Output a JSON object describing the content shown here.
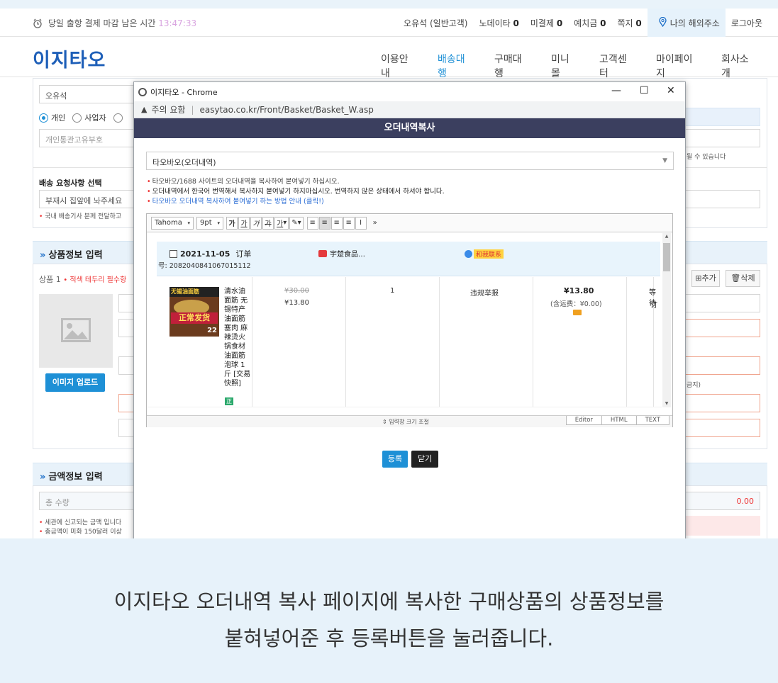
{
  "topbar": {
    "deadline_label": "당일 출항 결제 마감 남은 시간",
    "deadline_time": "13:47:33",
    "user": "오유석 (일반고객)",
    "items": [
      {
        "label": "노데이타",
        "count": "0"
      },
      {
        "label": "미결제",
        "count": "0"
      },
      {
        "label": "예치금",
        "count": "0"
      },
      {
        "label": "쪽지",
        "count": "0"
      }
    ],
    "my_address": "나의 해외주소",
    "logout": "로그아웃"
  },
  "nav": {
    "logo": "이지타오",
    "menu": [
      "이용안내",
      "배송대행",
      "구매대행",
      "미니몰",
      "고객센터",
      "마이페이지",
      "회사소개"
    ],
    "active_index": 1
  },
  "background": {
    "name_value": "오유석",
    "radio_personal": "개인",
    "radio_business": "사업자",
    "customs_placeholder": "개인통관고유부호",
    "right_hint": "될 수 있습니다",
    "delivery_request_label": "배송 요청사항 선택",
    "delivery_request_value": "부재시 집앞에 놔주세요",
    "delivery_note": "국내 배송기사 분께 전달하고",
    "product_section": "상품정보 입력",
    "product_line_label": "상품 1",
    "product_line_note": "적색 테두리 필수항",
    "btn_add": "추가",
    "btn_delete": "삭제",
    "image_upload": "이미지 업로드",
    "right_hint2": "금지)",
    "amount_section": "금액정보 입력",
    "total_qty_placeholder": "총 수량",
    "total_value": "0.00",
    "amount_note1": "세관에 신고되는 금액 입니다",
    "amount_note2": "총금액이 미화 150달러 이상"
  },
  "popup": {
    "window_title": "이지타오 - Chrome",
    "security_label": "주의 요함",
    "url": "easytao.co.kr/Front/Basket/Basket_W.asp",
    "header": "오더내역복사",
    "select_value": "타오바오(오더내역)",
    "note1": "타오바오/1688 사이트의 오더내역을 복사하여 붙여넣기 하십시오.",
    "note2": "오더내역에서 한국어 번역해서 복사하지 붙여넣기 하지마십시오. 번역하지 않은 상태에서 하셔야 합니다.",
    "note3": "타오바오 오더내역 복사하여 붙여넣기 하는 방법 안내 (클릭!)",
    "toolbar": {
      "font": "Tahoma",
      "size": "9pt",
      "more": "»"
    },
    "order": {
      "date": "2021-11-05",
      "order_word": "订单",
      "number_label": "号:",
      "number": "2082040841067015112",
      "shop": "宇楚食品…",
      "contact": "和我联系"
    },
    "product": {
      "title": "清水油面筋 无锡特产油面筋塞肉 麻辣烫火锅食材油面筋泡球 1斤 [交易快照]",
      "thumb_text1": "无锡油面筋",
      "thumb_text2": "正常发货",
      "thumb_badge": "22",
      "price_original": "¥30.00",
      "price_now": "¥13.80",
      "quantity": "1",
      "status": "违规举报",
      "total": "¥13.80",
      "shipping": "(含运费：¥0.00)",
      "cut_text": "等待",
      "cut_text2": "订"
    },
    "resize_label": "입력창 크기 조절",
    "tabs": [
      "Editor",
      "HTML",
      "TEXT"
    ],
    "btn_register": "등록",
    "btn_close": "닫기"
  },
  "caption": {
    "line1": "이지타오 오더내역 복사 페이지에 복사한 구매상품의 상품정보를",
    "line2": "붙혀넣어준 후 등록버튼을 눌러줍니다."
  }
}
